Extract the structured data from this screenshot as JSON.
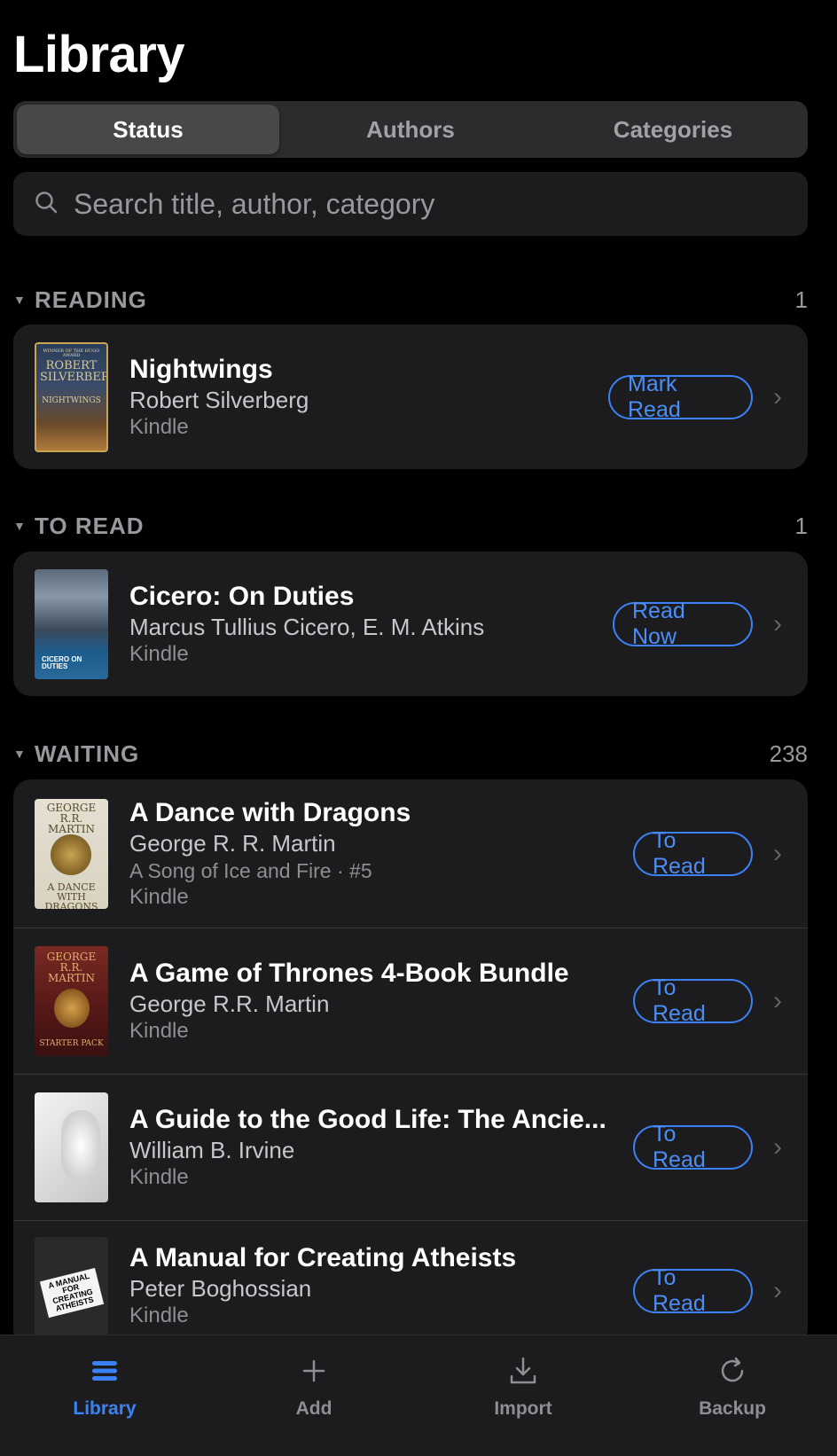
{
  "header": {
    "title": "Library"
  },
  "segments": [
    {
      "label": "Status",
      "active": true
    },
    {
      "label": "Authors",
      "active": false
    },
    {
      "label": "Categories",
      "active": false
    }
  ],
  "search": {
    "placeholder": "Search title, author, category",
    "icon": "search-icon"
  },
  "sections": {
    "reading": {
      "title": "READING",
      "count": "1",
      "books": [
        {
          "title": "Nightwings",
          "author": "Robert Silverberg",
          "format": "Kindle",
          "action": "Mark Read",
          "cover_top": "WINNER OF THE HUGO AWARD",
          "cover_author": "ROBERT SILVERBERG",
          "cover_title": "NIGHTWINGS"
        }
      ]
    },
    "to_read": {
      "title": "TO READ",
      "count": "1",
      "books": [
        {
          "title": "Cicero: On Duties",
          "author": "Marcus Tullius Cicero, E. M. Atkins",
          "format": "Kindle",
          "action": "Read Now",
          "cover_title": "CICERO ON DUTIES"
        }
      ]
    },
    "waiting": {
      "title": "WAITING",
      "count": "238",
      "books": [
        {
          "title": "A Dance with Dragons",
          "author": "George R. R. Martin",
          "series": "A Song of Ice and Fire · #5",
          "format": "Kindle",
          "action": "To Read",
          "cover_author": "GEORGE R.R. MARTIN",
          "cover_title": "A DANCE WITH DRAGONS"
        },
        {
          "title": "A Game of Thrones 4-Book Bundle",
          "author": "George R.R. Martin",
          "format": "Kindle",
          "action": "To Read",
          "cover_author": "GEORGE R.R. MARTIN",
          "cover_title": "STARTER PACK"
        },
        {
          "title": "A Guide to the Good Life: The Ancie...",
          "author": "William B. Irvine",
          "format": "Kindle",
          "action": "To Read"
        },
        {
          "title": "A Manual for Creating Atheists",
          "author": "Peter Boghossian",
          "format": "Kindle",
          "action": "To Read",
          "cover_title": "A MANUAL FOR CREATING ATHEISTS"
        }
      ]
    }
  },
  "tabbar": [
    {
      "label": "Library",
      "icon": "library-icon",
      "active": true
    },
    {
      "label": "Add",
      "icon": "plus-icon",
      "active": false
    },
    {
      "label": "Import",
      "icon": "download-icon",
      "active": false
    },
    {
      "label": "Backup",
      "icon": "refresh-icon",
      "active": false
    }
  ],
  "colors": {
    "accent": "#3b82f6",
    "background": "#000000",
    "card": "#1c1c1e"
  }
}
